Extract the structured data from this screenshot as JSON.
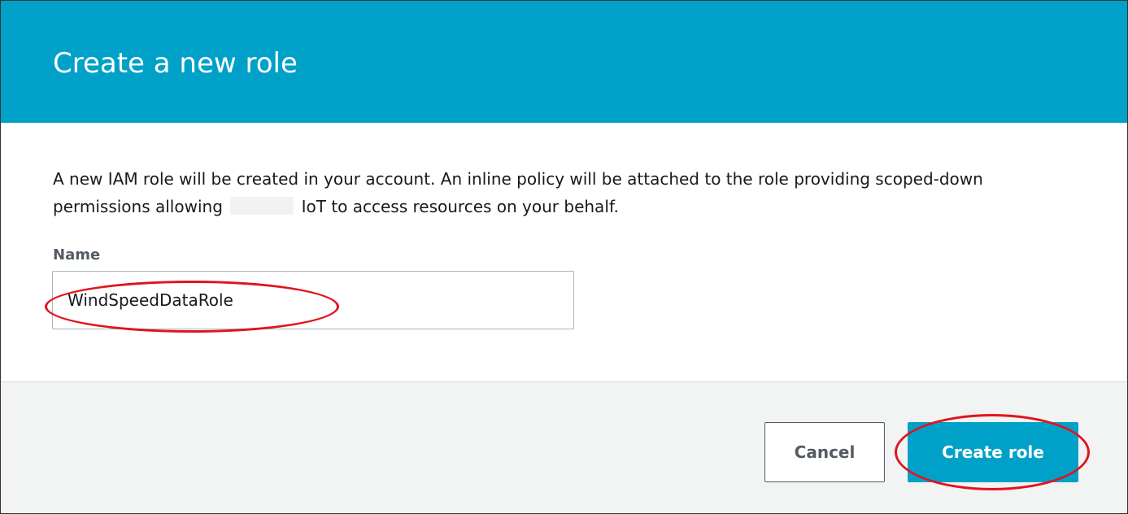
{
  "dialog": {
    "title": "Create a new role",
    "description_part1": "A new IAM role will be created in your account. An inline policy will be attached to the role providing scoped-down permissions allowing",
    "description_part2": "IoT to access resources on your behalf.",
    "name_label": "Name",
    "name_value": "WindSpeedDataRole"
  },
  "footer": {
    "cancel_label": "Cancel",
    "create_label": "Create role"
  },
  "colors": {
    "header_bg": "#00a1c9",
    "primary_button": "#00a1c9",
    "annotation": "#e0141e",
    "footer_bg": "#f2f3f3"
  }
}
